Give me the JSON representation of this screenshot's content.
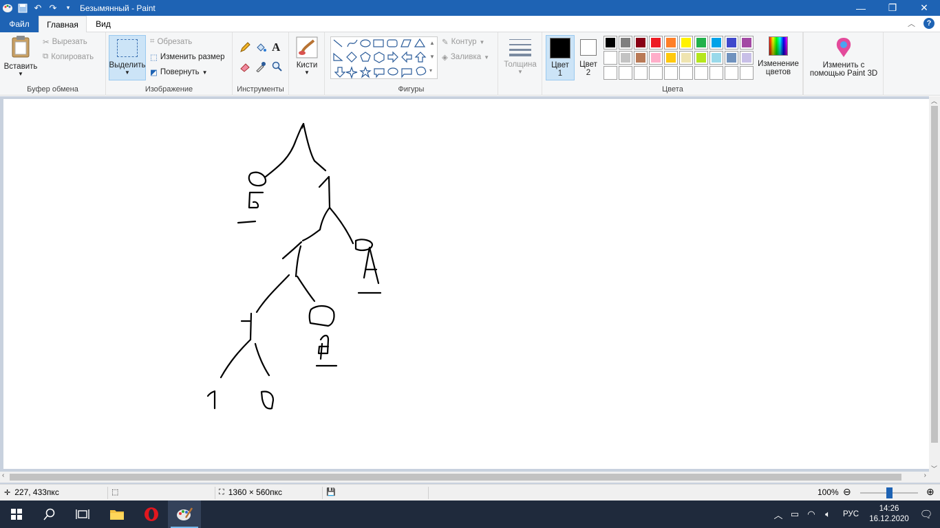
{
  "window": {
    "title": "Безымянный - Paint"
  },
  "tabs": {
    "file": "Файл",
    "home": "Главная",
    "view": "Вид"
  },
  "clipboard": {
    "paste": "Вставить",
    "cut": "Вырезать",
    "copy": "Копировать",
    "label": "Буфер обмена"
  },
  "image": {
    "select": "Выделить",
    "crop": "Обрезать",
    "resize": "Изменить размер",
    "rotate": "Повернуть",
    "label": "Изображение"
  },
  "tools": {
    "label": "Инструменты"
  },
  "brushes": {
    "label": "Кисти"
  },
  "shapes": {
    "outline": "Контур",
    "fill": "Заливка",
    "label": "Фигуры"
  },
  "size": {
    "label": "Толщина"
  },
  "colors": {
    "color1_line1": "Цвет",
    "color1_line2": "1",
    "color2_line1": "Цвет",
    "color2_line2": "2",
    "edit_line1": "Изменение",
    "edit_line2": "цветов",
    "label": "Цвета",
    "color1_value": "#000000",
    "color2_value": "#ffffff",
    "palette": [
      "#000000",
      "#7f7f7f",
      "#880015",
      "#ed1c24",
      "#ff7f27",
      "#fff200",
      "#22b14c",
      "#00a2e8",
      "#3f48cc",
      "#a349a4",
      "#ffffff",
      "#c3c3c3",
      "#b97a57",
      "#ffaec9",
      "#ffc90e",
      "#efe4b0",
      "#b5e61d",
      "#99d9ea",
      "#7092be",
      "#c8bfe7",
      "#ffffff",
      "#ffffff",
      "#ffffff",
      "#ffffff",
      "#ffffff",
      "#ffffff",
      "#ffffff",
      "#ffffff",
      "#ffffff",
      "#ffffff"
    ]
  },
  "paint3d": {
    "line1": "Изменить с",
    "line2": "помощью Paint 3D"
  },
  "status": {
    "cursor": "227, 433пкс",
    "dimensions": "1360 × 560пкс",
    "zoom": "100%",
    "zoom_level": 0.5
  },
  "taskbar": {
    "lang": "РУС",
    "time": "14:26",
    "date": "16.12.2020"
  },
  "accent": "#1e63b4"
}
